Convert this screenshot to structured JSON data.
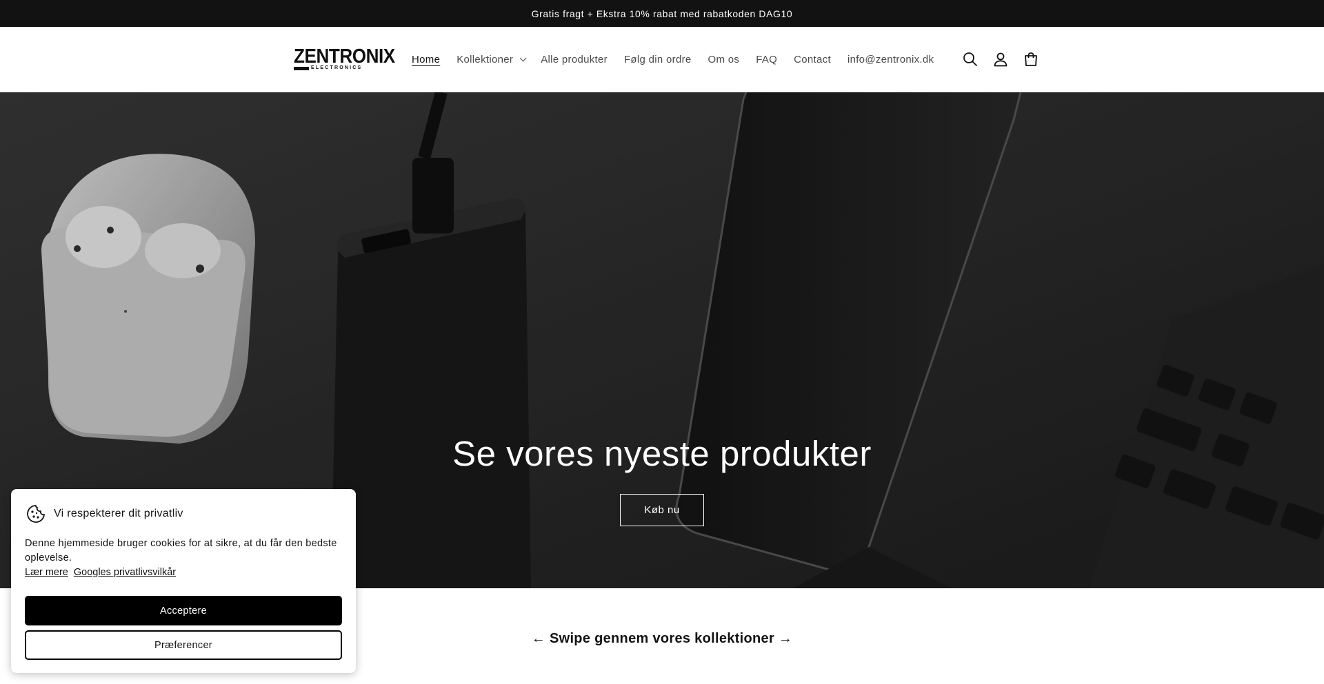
{
  "announcement": {
    "text": "Gratis fragt + Ekstra 10% rabat med rabatkoden DAG10"
  },
  "header": {
    "logo_main": "ZENTRONIX",
    "logo_sub": "ELECTRONICS",
    "nav": [
      {
        "label": "Home",
        "active": true
      },
      {
        "label": "Kollektioner",
        "dropdown": true
      },
      {
        "label": "Alle produkter"
      },
      {
        "label": "Følg din ordre"
      },
      {
        "label": "Om os"
      },
      {
        "label": "FAQ"
      },
      {
        "label": "Contact"
      },
      {
        "label": "info@zentronix.dk"
      }
    ],
    "icons": [
      "search-icon",
      "account-icon",
      "cart-icon"
    ]
  },
  "hero": {
    "title": "Se vores nyeste produkter",
    "button": "Køb nu"
  },
  "collections": {
    "title": "← Swipe gennem vores kollektioner →"
  },
  "cookie": {
    "title": "Vi respekterer dit privatliv",
    "text": "Denne hjemmeside bruger cookies for at sikre, at du får den bedste oplevelse.",
    "link_learn": "Lær mere",
    "link_google": "Googles privatlivsvilkår",
    "accept": "Acceptere",
    "preferences": "Præferencer"
  },
  "colors": {
    "dark": "#121212",
    "white": "#ffffff"
  }
}
